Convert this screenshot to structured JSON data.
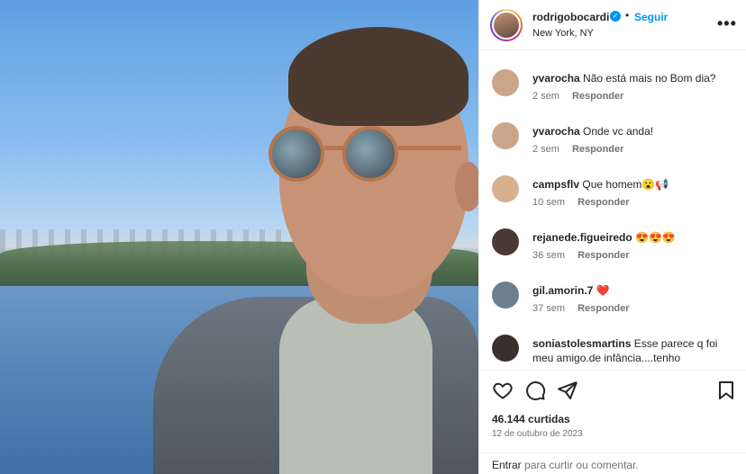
{
  "post": {
    "username": "rodrigobocardi",
    "verified_icon": "verified-badge-icon",
    "separator": "•",
    "follow_label": "Seguir",
    "location": "New York, NY",
    "more_icon": "more-options-icon",
    "more_label": "•••"
  },
  "comments": [
    {
      "user": "yvarocha",
      "text": "Não está mais no Bom dia?",
      "time": "2 sem",
      "reply": "Responder",
      "avatar_color": "#caa58a"
    },
    {
      "user": "yvarocha",
      "text": "Onde vc anda!",
      "time": "2 sem",
      "reply": "Responder",
      "avatar_color": "#caa58a"
    },
    {
      "user": "campsflv",
      "text": "Que homem😮📢",
      "time": "10 sem",
      "reply": "Responder",
      "avatar_color": "#d7b08e"
    },
    {
      "user": "rejanede.figueiredo",
      "text": "😍😍😍",
      "time": "36 sem",
      "reply": "Responder",
      "avatar_color": "#4a3a33"
    },
    {
      "user": "gil.amorin.7",
      "text": "❤️",
      "time": "37 sem",
      "reply": "Responder",
      "avatar_color": "#6b7f8e"
    },
    {
      "user": "soniastolesmartins",
      "text": "Esse parece q foi meu amigo.de infância....tenho",
      "time": "",
      "reply": "",
      "avatar_color": "#3a2f2a"
    }
  ],
  "actions": {
    "like_icon": "heart-icon",
    "comment_icon": "comment-icon",
    "share_icon": "share-icon",
    "save_icon": "bookmark-icon"
  },
  "likes": "46.144 curtidas",
  "date": "12 de outubro de 2023",
  "composer": {
    "placeholder_pre": "Entrar",
    "placeholder_post": "para curtir ou comentar."
  },
  "colors": {
    "accent": "#0095f6",
    "muted": "#737373",
    "text": "#262626"
  }
}
